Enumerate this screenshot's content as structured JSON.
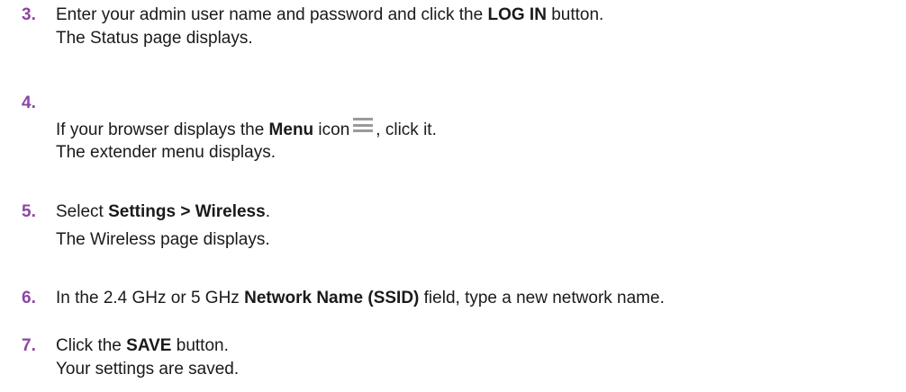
{
  "steps": [
    {
      "number": "3.",
      "line1": {
        "a": "Enter your admin user name and password and click the ",
        "b": "LOG IN",
        "c": " button."
      },
      "line2": "The Status page displays."
    },
    {
      "number": "4.",
      "line1": {
        "a": "If your browser displays the ",
        "b": "Menu",
        "c": " icon",
        "d": ", click it."
      },
      "line2": "The extender menu displays.",
      "icon": "hamburger-menu-icon"
    },
    {
      "number": "5.",
      "line1": {
        "a": "Select ",
        "b": "Settings > Wireless",
        "c": "."
      },
      "line2": "The Wireless page displays."
    },
    {
      "number": "6.",
      "line1": {
        "a": "In the 2.4 GHz or 5 GHz ",
        "b": "Network Name (SSID)",
        "c": " field, type a new network name."
      }
    },
    {
      "number": "7.",
      "line1": {
        "a": "Click the ",
        "b": "SAVE",
        "c": " button."
      },
      "line2": "Your settings are saved."
    }
  ],
  "colors": {
    "step_number": "#8e44a6",
    "text": "#1a1a1a",
    "icon": "#9a9a9a"
  }
}
